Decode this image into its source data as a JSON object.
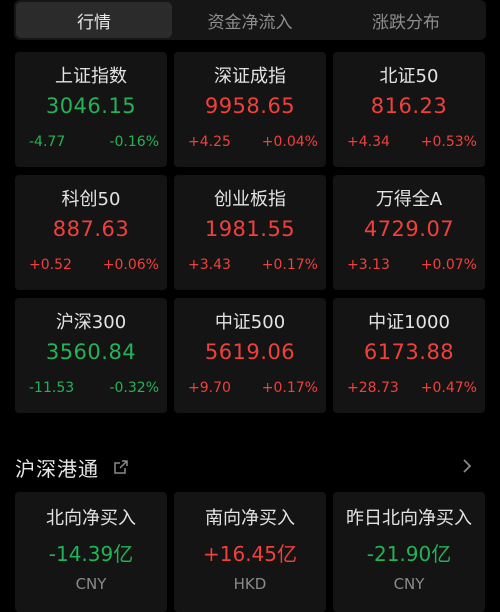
{
  "tabs": [
    {
      "label": "行情"
    },
    {
      "label": "资金净流入"
    },
    {
      "label": "涨跌分布"
    }
  ],
  "indices": [
    {
      "name": "上证指数",
      "value": "3046.15",
      "change": "-4.77",
      "pct": "-0.16%",
      "direction": "down"
    },
    {
      "name": "深证成指",
      "value": "9958.65",
      "change": "+4.25",
      "pct": "+0.04%",
      "direction": "up"
    },
    {
      "name": "北证50",
      "value": "816.23",
      "change": "+4.34",
      "pct": "+0.53%",
      "direction": "up"
    },
    {
      "name": "科创50",
      "value": "887.63",
      "change": "+0.52",
      "pct": "+0.06%",
      "direction": "up"
    },
    {
      "name": "创业板指",
      "value": "1981.55",
      "change": "+3.43",
      "pct": "+0.17%",
      "direction": "up"
    },
    {
      "name": "万得全A",
      "value": "4729.07",
      "change": "+3.13",
      "pct": "+0.07%",
      "direction": "up"
    },
    {
      "name": "沪深300",
      "value": "3560.84",
      "change": "-11.53",
      "pct": "-0.32%",
      "direction": "down"
    },
    {
      "name": "中证500",
      "value": "5619.06",
      "change": "+9.70",
      "pct": "+0.17%",
      "direction": "up"
    },
    {
      "name": "中证1000",
      "value": "6173.88",
      "change": "+28.73",
      "pct": "+0.47%",
      "direction": "up"
    }
  ],
  "connect": {
    "title": "沪深港通",
    "icons": {
      "external": "external-link-icon",
      "chevron": "chevron-right-icon"
    },
    "items": [
      {
        "name": "北向净买入",
        "value": "-14.39亿",
        "currency": "CNY",
        "direction": "down"
      },
      {
        "name": "南向净买入",
        "value": "+16.45亿",
        "currency": "HKD",
        "direction": "up"
      },
      {
        "name": "昨日北向净买入",
        "value": "-21.90亿",
        "currency": "CNY",
        "direction": "down"
      }
    ]
  },
  "colors": {
    "up": "#f0403c",
    "down": "#23b356",
    "background": "#000000",
    "card": "#141414"
  }
}
